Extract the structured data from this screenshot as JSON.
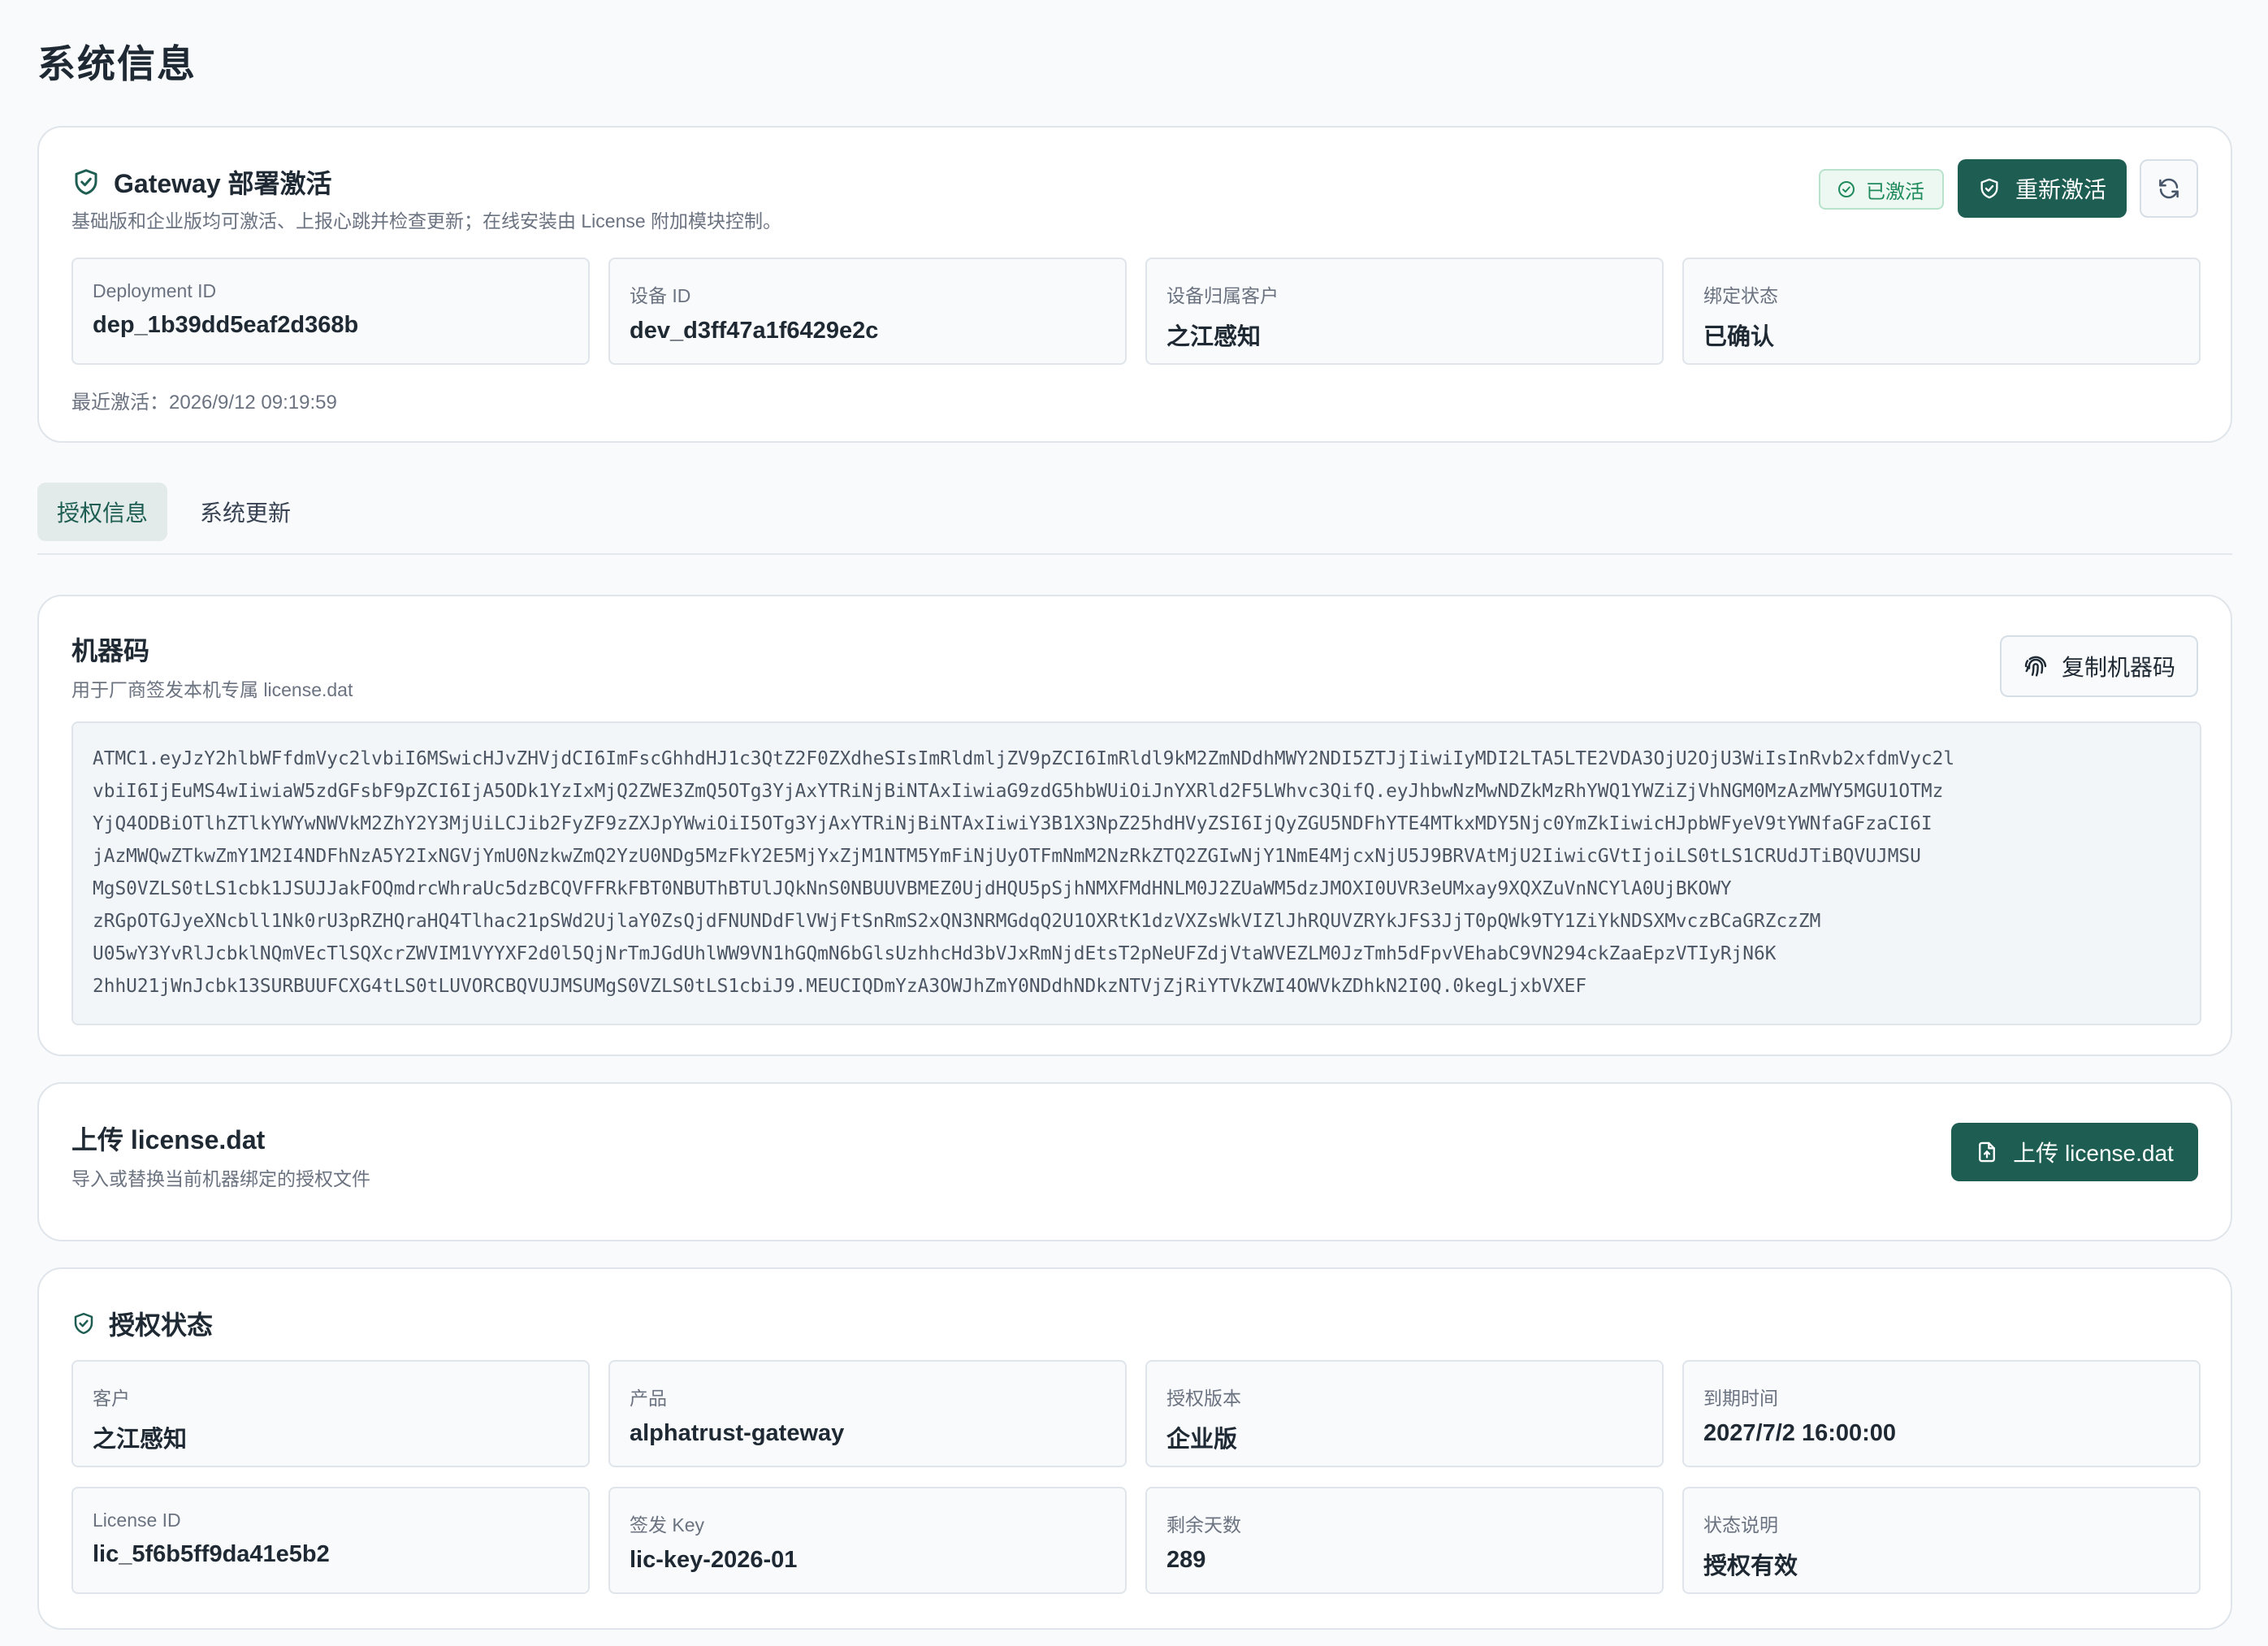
{
  "page": {
    "title": "系统信息"
  },
  "gateway": {
    "title": "Gateway 部署激活",
    "subtitle": "基础版和企业版均可激活、上报心跳并检查更新；在线安装由 License 附加模块控制。",
    "status_badge": "已激活",
    "reactivate_label": "重新激活",
    "fields": [
      {
        "label": "Deployment ID",
        "value": "dep_1b39dd5eaf2d368b"
      },
      {
        "label": "设备 ID",
        "value": "dev_d3ff47a1f6429e2c"
      },
      {
        "label": "设备归属客户",
        "value": "之江感知"
      },
      {
        "label": "绑定状态",
        "value": "已确认"
      }
    ],
    "last_activated": "最近激活：2026/9/12 09:19:59"
  },
  "tabs": [
    {
      "label": "授权信息",
      "active": true
    },
    {
      "label": "系统更新",
      "active": false
    }
  ],
  "machine_code": {
    "title": "机器码",
    "subtitle": "用于厂商签发本机专属 license.dat",
    "copy_label": "复制机器码",
    "lines": [
      "ATMC1.eyJzY2hlbWFfdmVyc2lvbiI6MSwicHJvZHVjdCI6ImFscGhhdHJ1c3QtZ2F0ZXdheSIsImRldmljZV9pZCI6ImRldl9kM2ZmNDdhMWY2NDI5ZTJjIiwiIyMDI2LTA5LTE2VDA3OjU2OjU3WiIsInRvb2xfdmVyc2l",
      "vbiI6IjEuMS4wIiwiaW5zdGFsbF9pZCI6IjA5ODk1YzIxMjQ2ZWE3ZmQ5OTg3YjAxYTRiNjBiNTAxIiwiaG9zdG5hbWUiOiJnYXRld2F5LWhvc3QifQ.eyJhbwNzMwNDZkMzRhYWQ1YWZiZjVhNGM0MzAzMWY5MGU1OTMz",
      "YjQ4ODBiOTlhZTlkYWYwNWVkM2ZhY2Y3MjUiLCJib2FyZF9zZXJpYWwiOiI5OTg3YjAxYTRiNjBiNTAxIiwiY3B1X3NpZ25hdHVyZSI6IjQyZGU5NDFhYTE4MTkxMDY5Njc0YmZkIiwicHJpbWFyeV9tYWNfaGFzaCI6I",
      "jAzMWQwZTkwZmY1M2I4NDFhNzA5Y2IxNGVjYmU0NzkwZmQ2YzU0NDg5MzFkY2E5MjYxZjM1NTM5YmFiNjUyOTFmNmM2NzRkZTQ2ZGIwNjY1NmE4MjcxNjU5J9BRVAtMjU2IiwicGVtIjoiLS0tLS1CRUdJTiBQVUJMSU",
      "MgS0VZLS0tLS1cbk1JSUJJakFOQmdrcWhraUc5dzBCQVFFRkFBT0NBUThBTUlJQkNnS0NBUUVBMEZ0UjdHQU5pSjhNMXFMdHNLM0J2ZUaWM5dzJMOXI0UVR3eUMxay9XQXZuVnNCYlA0UjBKOWY",
      "zRGpOTGJyeXNcbll1Nk0rU3pRZHQraHQ4Tlhac21pSWd2UjlaY0ZsQjdFNUNDdFlVWjFtSnRmS2xQN3NRMGdqQ2U1OXRtK1dzVXZsWkVIZlJhRQUVZRYkJFS3JjT0pQWk9TY1ZiYkNDSXMvczBCaGRZczZM",
      "U05wY3YvRlJcbklNQmVEcTlSQXcrZWVIM1VYYXF2d0l5QjNrTmJGdUhlWW9VN1hGQmN6bGlsUzhhcHd3bVJxRmNjdEtsT2pNeUFZdjVtaWVEZLM0JzTmh5dFpvVEhabC9VN294ckZaaEpzVTIyRjN6K",
      "2hhU21jWnJcbk13SURBUUFCXG4tLS0tLUVORCBQVUJMSUMgS0VZLS0tLS1cbiJ9.MEUCIQDmYzA3OWJhZmY0NDdhNDkzNTVjZjRiYTVkZWI4OWVkZDhkN2I0Q.0kegLjxbVXEF"
    ]
  },
  "upload": {
    "title": "上传 license.dat",
    "subtitle": "导入或替换当前机器绑定的授权文件",
    "button_label": "上传 license.dat"
  },
  "license_status": {
    "title": "授权状态",
    "fields": [
      {
        "label": "客户",
        "value": "之江感知"
      },
      {
        "label": "产品",
        "value": "alphatrust-gateway"
      },
      {
        "label": "授权版本",
        "value": "企业版"
      },
      {
        "label": "到期时间",
        "value": "2027/7/2 16:00:00"
      },
      {
        "label": "License ID",
        "value": "lic_5f6b5ff9da41e5b2"
      },
      {
        "label": "签发 Key",
        "value": "lic-key-2026-01"
      },
      {
        "label": "剩余天数",
        "value": "289"
      },
      {
        "label": "状态说明",
        "value": "授权有效"
      }
    ]
  },
  "colors": {
    "accent": "#1d5d52",
    "success": "#1f8a5c",
    "border": "#dfe5ea"
  },
  "icons": [
    "shield-check-icon",
    "check-circle-icon",
    "refresh-icon",
    "fingerprint-icon",
    "file-upload-icon"
  ]
}
